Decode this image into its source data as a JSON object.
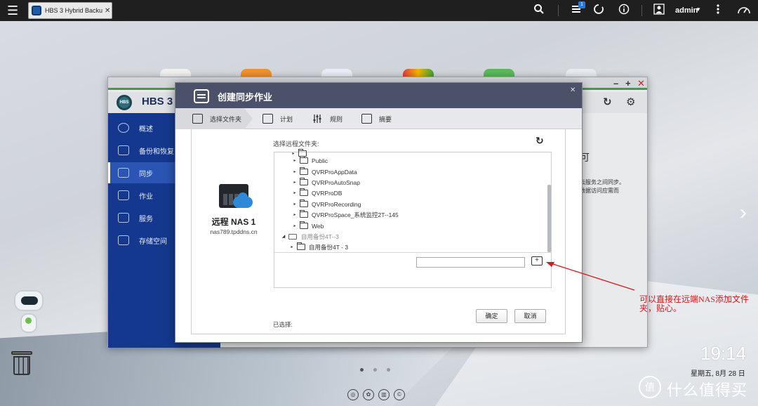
{
  "topbar": {
    "tab_label": "HBS 3 Hybrid Backu...",
    "tab_close": "✕",
    "notification_count": "1",
    "username": "admin"
  },
  "hbs": {
    "title": "HBS 3",
    "sidebar": [
      {
        "label": "概述",
        "icon": "speedometer-icon"
      },
      {
        "label": "备份和恢复",
        "icon": "backup-icon"
      },
      {
        "label": "同步",
        "icon": "sync-icon",
        "active": true
      },
      {
        "label": "作业",
        "icon": "job-icon"
      },
      {
        "label": "服务",
        "icon": "service-icon"
      },
      {
        "label": "存储空间",
        "icon": "storage-icon"
      }
    ],
    "content_fragments": [
      "可",
      "云服务之间同步。",
      "数据访问应需而"
    ]
  },
  "dialog": {
    "title": "创建同步作业",
    "steps": [
      "选择文件夹",
      "计划",
      "规则",
      "摘要"
    ],
    "nas_name": "远程 NAS 1",
    "nas_host": "nas789.tpddns.cn",
    "select_label": "选择远程文件夹:",
    "tree": [
      {
        "label": "Public",
        "type": "folder"
      },
      {
        "label": "QVRProAppData",
        "type": "folder"
      },
      {
        "label": "QVRProAutoSnap",
        "type": "folder"
      },
      {
        "label": "QVRProDB",
        "type": "folder"
      },
      {
        "label": "QVRProRecording",
        "type": "folder"
      },
      {
        "label": "QVRProSpace_系统监控2T--145",
        "type": "folder"
      },
      {
        "label": "Web",
        "type": "folder"
      },
      {
        "label": "自用备份4T--3",
        "type": "drive"
      },
      {
        "label": "自用备份4T - 3",
        "type": "folder"
      }
    ],
    "new_folder_value": "",
    "selected_label": "已选择:",
    "ok_label": "确定",
    "cancel_label": "取消"
  },
  "annotation": {
    "text": "可以直接在远端NAS添加文件夹，贴心。",
    "color": "#d6191c"
  },
  "desktop": {
    "time": "19:14",
    "date": "星期五, 8月 28 日",
    "watermark": "什么值得买",
    "watermark_logo": "值"
  }
}
